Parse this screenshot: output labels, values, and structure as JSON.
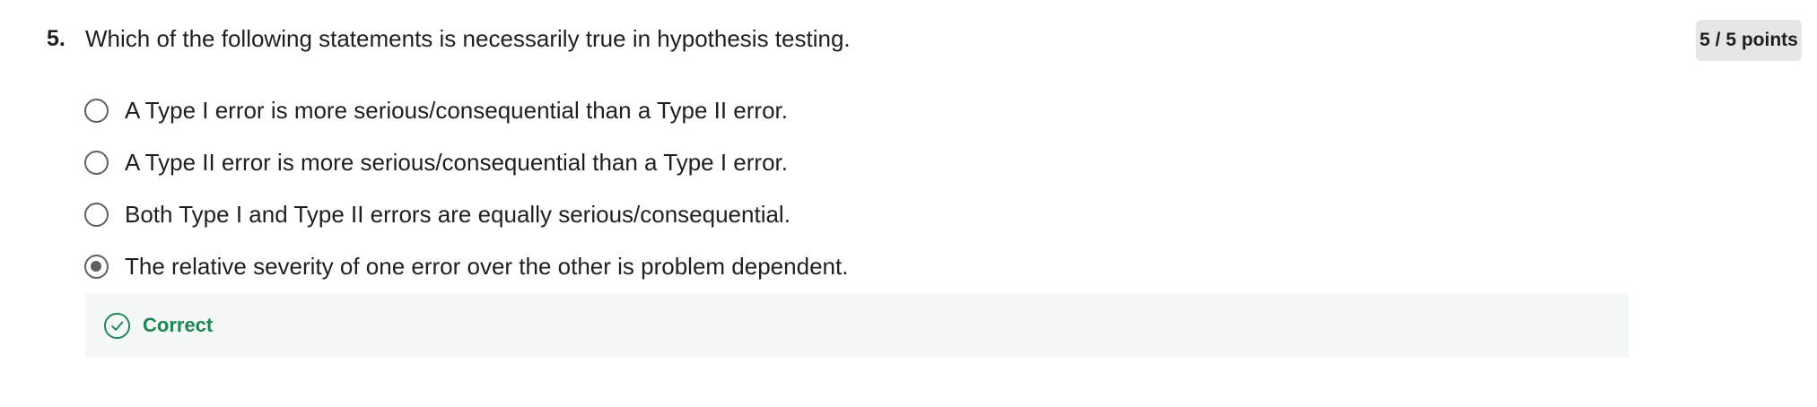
{
  "question": {
    "number": "5.",
    "text": "Which of the following statements is necessarily true in hypothesis testing.",
    "points": "5 / 5 points",
    "options": [
      {
        "label": "A Type I error is more serious/consequential than a Type II error.",
        "selected": false
      },
      {
        "label": "A Type II error is more serious/consequential than a Type I error.",
        "selected": false
      },
      {
        "label": "Both Type I and Type II errors are equally serious/consequential.",
        "selected": false
      },
      {
        "label": "The relative severity of one error over the other is problem dependent.",
        "selected": true
      }
    ],
    "feedback": {
      "label": "Correct",
      "icon": "check-circle-icon",
      "color": "#1f8354",
      "background": "#f4f9f7"
    }
  }
}
